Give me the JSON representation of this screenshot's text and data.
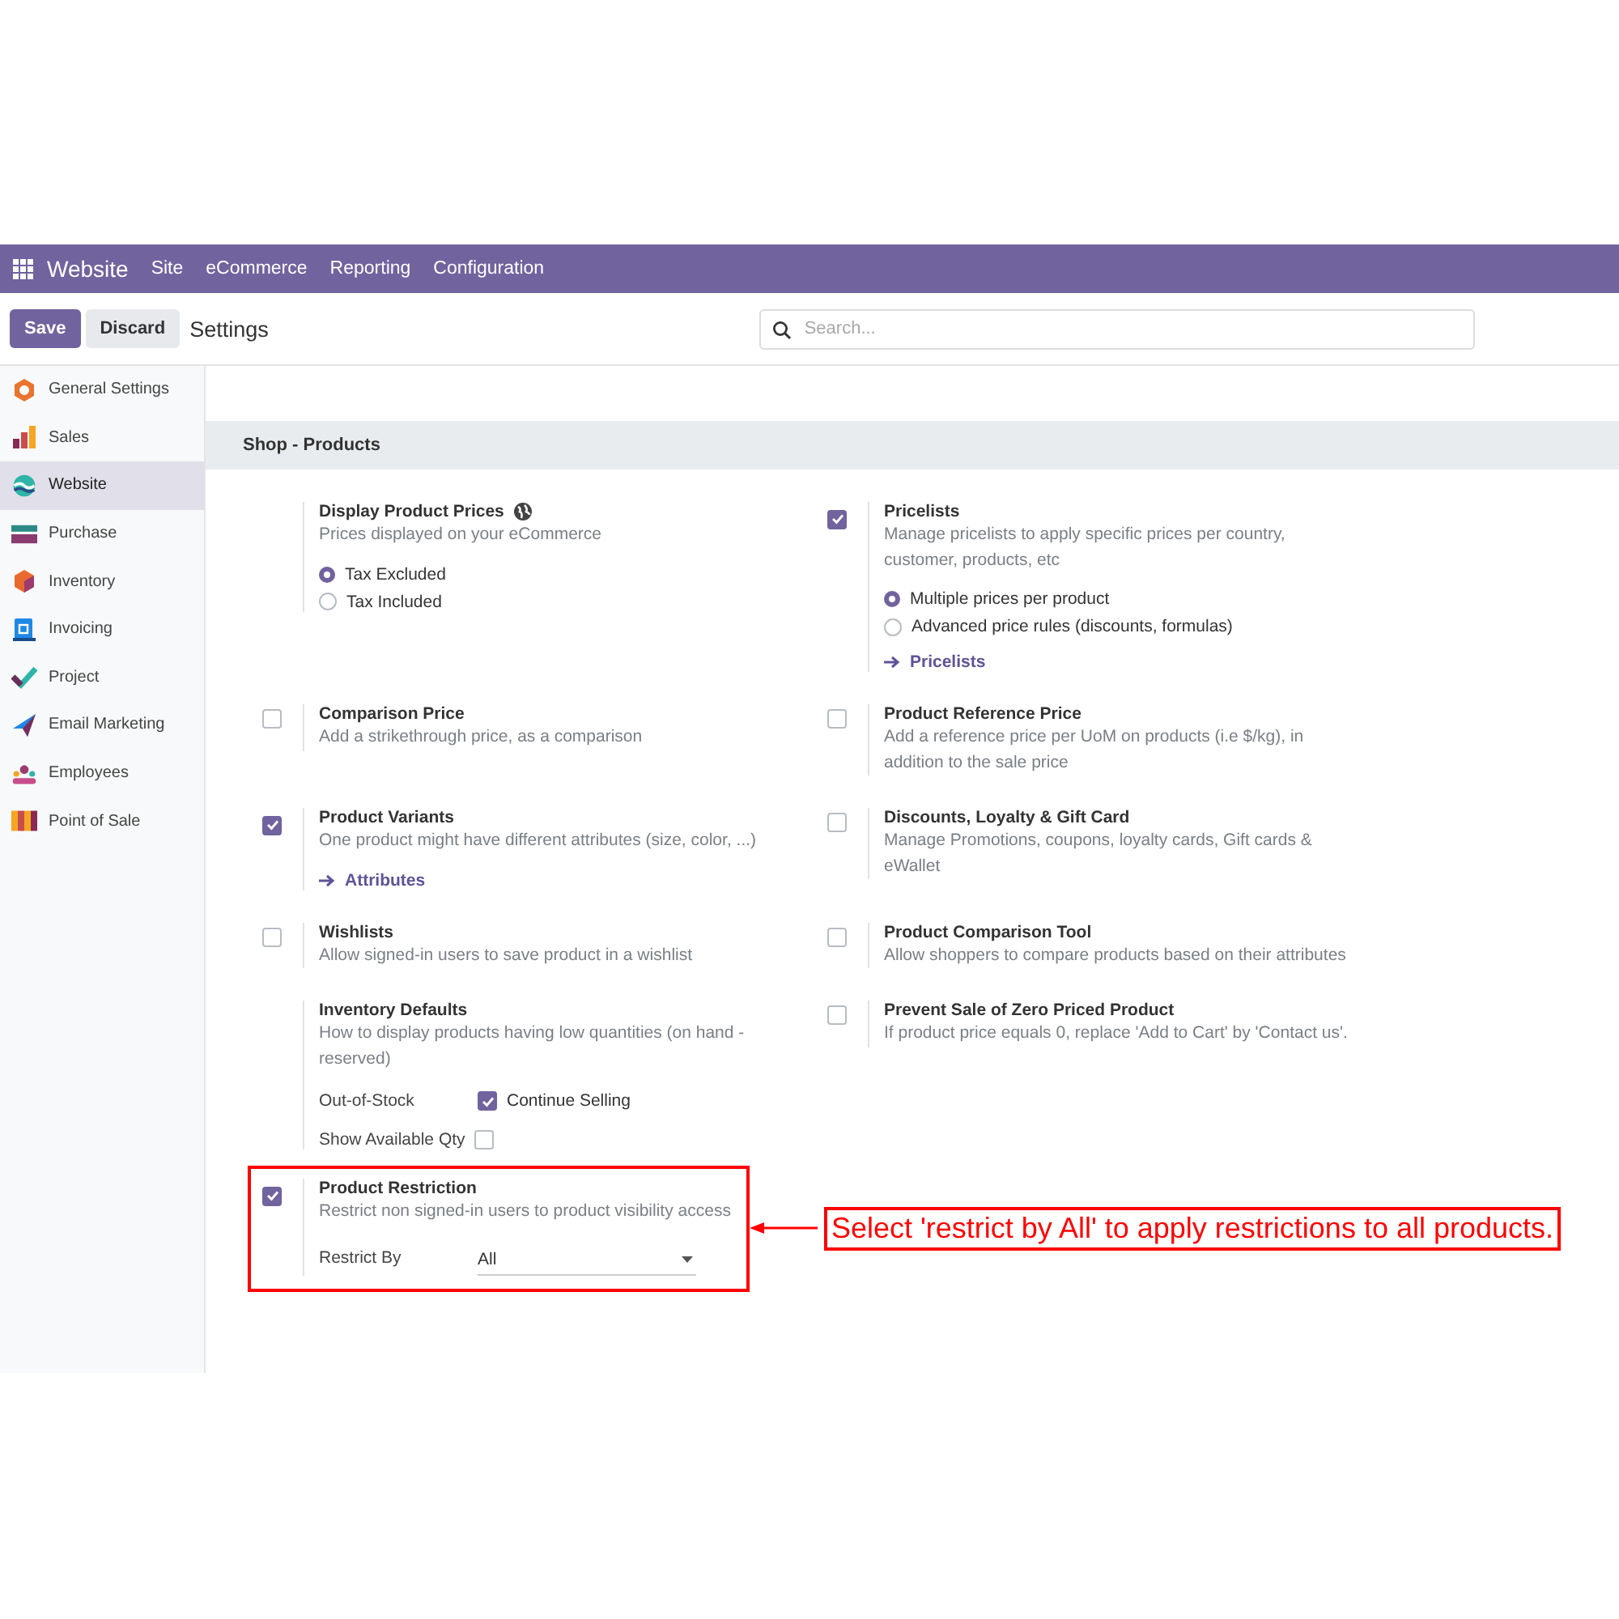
{
  "navbar": {
    "app_name": "Website",
    "menus": [
      "Site",
      "eCommerce",
      "Reporting",
      "Configuration"
    ]
  },
  "control_panel": {
    "buttons": [
      {
        "label": "Save",
        "kind": "primary"
      },
      {
        "label": "Discard",
        "kind": "secondary"
      }
    ],
    "title": "Settings",
    "search": {
      "placeholder": "Search..."
    }
  },
  "sidebar": {
    "items": [
      {
        "label": "General Settings",
        "selected": false
      },
      {
        "label": "Sales",
        "selected": false
      },
      {
        "label": "Website",
        "selected": true
      },
      {
        "label": "Purchase",
        "selected": false
      },
      {
        "label": "Inventory",
        "selected": false
      },
      {
        "label": "Invoicing",
        "selected": false
      },
      {
        "label": "Project",
        "selected": false
      },
      {
        "label": "Email Marketing",
        "selected": false
      },
      {
        "label": "Employees",
        "selected": false
      },
      {
        "label": "Point of Sale",
        "selected": false
      }
    ]
  },
  "section": {
    "title": "Shop - Products",
    "settings": [
      {
        "title": "Display Product Prices",
        "info_icon": true,
        "description": "Prices displayed on your eCommerce",
        "options": [
          {
            "label": "Tax Excluded",
            "selected": true
          },
          {
            "label": "Tax Included",
            "selected": false
          }
        ]
      },
      {
        "title": "Pricelists",
        "checked": true,
        "description": "Manage pricelists to apply specific prices per country, customer, products, etc",
        "options": [
          {
            "label": "Multiple prices per product",
            "selected": true
          },
          {
            "label": "Advanced price rules (discounts, formulas)",
            "selected": false
          }
        ],
        "link": "Pricelists"
      },
      {
        "title": "Comparison Price",
        "checked": false,
        "description": "Add a strikethrough price, as a comparison"
      },
      {
        "title": "Product Reference Price",
        "checked": false,
        "description": "Add a reference price per UoM on products (i.e $/kg), in addition to the sale price"
      },
      {
        "title": "Product Variants",
        "checked": true,
        "description": "One product might have different attributes (size, color, ...)",
        "link": "Attributes"
      },
      {
        "title": "Discounts, Loyalty & Gift Card",
        "checked": false,
        "description": "Manage Promotions, coupons, loyalty cards, Gift cards & eWallet"
      },
      {
        "title": "Wishlists",
        "checked": false,
        "description": "Allow signed-in users to save product in a wishlist"
      },
      {
        "title": "Product Comparison Tool",
        "checked": false,
        "description": "Allow shoppers to compare products based on their attributes"
      },
      {
        "title": "Inventory Defaults",
        "description": "How to display products having low quantities (on hand - reserved)",
        "fields": [
          {
            "kind": "checkbox",
            "label": "Out-of-Stock",
            "checked": true,
            "text": "Continue Selling"
          },
          {
            "kind": "checkbox",
            "label": "Show Available Qty",
            "checked": false
          }
        ]
      },
      {
        "title": "Prevent Sale of Zero Priced Product",
        "checked": false,
        "description": "If product price equals 0, replace 'Add to Cart' by 'Contact us'."
      },
      {
        "title": "Product Restriction",
        "checked": true,
        "description": "Restrict non signed-in users to product visibility access",
        "fields": [
          {
            "kind": "select",
            "label": "Restrict By",
            "value": "All"
          }
        ],
        "highlighted": true,
        "callout": "Select 'restrict by All' to apply restrictions to all products."
      }
    ]
  }
}
